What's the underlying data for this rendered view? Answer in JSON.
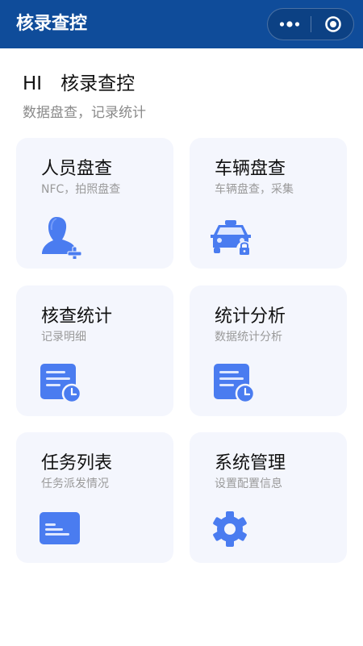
{
  "nav": {
    "title": "核录查控",
    "more_icon": "more-dots-icon",
    "close_icon": "target-close-icon"
  },
  "header": {
    "greeting": "HI　核录查控",
    "subtitle": "数据盘查，记录统计"
  },
  "colors": {
    "nav_bg": "#0f4c9a",
    "card_bg": "#f4f6fd",
    "icon_blue": "#4a7cf0"
  },
  "cards": [
    {
      "title": "人员盘查",
      "subtitle": "NFC，拍照盘查",
      "icon": "person-add-icon"
    },
    {
      "title": "车辆盘查",
      "subtitle": "车辆盘查，采集",
      "icon": "car-lock-icon"
    },
    {
      "title": "核查统计",
      "subtitle": "记录明细",
      "icon": "document-clock-icon"
    },
    {
      "title": "统计分析",
      "subtitle": "数据统计分析",
      "icon": "document-clock-icon"
    },
    {
      "title": "任务列表",
      "subtitle": "任务派发情况",
      "icon": "card-list-icon"
    },
    {
      "title": "系统管理",
      "subtitle": "设置配置信息",
      "icon": "gear-icon"
    }
  ]
}
